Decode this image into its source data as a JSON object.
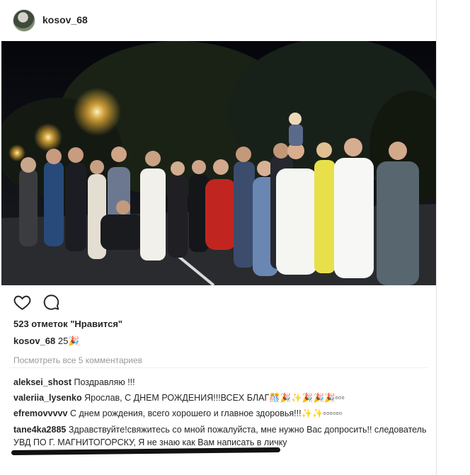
{
  "header": {
    "username": "kosov_68"
  },
  "photo": {
    "alt_icon": "night-group-photo"
  },
  "actions": {
    "like_icon": "heart-icon",
    "comment_icon": "comment-bubble-icon"
  },
  "likes_text": "523 отметок \"Нравится\"",
  "caption": {
    "author": "kosov_68",
    "text": "25🎉"
  },
  "view_all_comments": "Посмотреть все 5 комментариев",
  "comments": [
    {
      "author": "aleksei_shost",
      "text": "Поздравляю !!!"
    },
    {
      "author": "valeriia_lysenko",
      "text": "Ярослав, С ДНЕМ РОЖДЕНИЯ!!!ВСЕХ БЛАГ🎊🎉✨🎉🎉🎉▫▫▫"
    },
    {
      "author": "efremovvvvv",
      "text": "С днем рождения, всего хорошего и главное здоровья!!!✨✨▫▫▫▫▫▫"
    },
    {
      "author": "tane4ka2885",
      "text": "Здравствуйте!свяжитесь со мной пожалуйста, мне нужно Вас допросить!! следователь УВД ПО Г. МАГНИТОГОРСКУ, Я не знаю как Вам написать в личку"
    }
  ]
}
